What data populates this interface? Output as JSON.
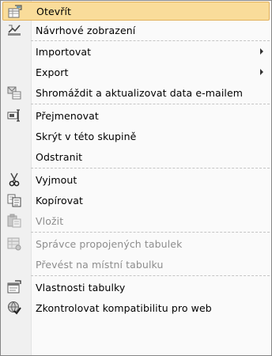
{
  "menu": {
    "items": [
      {
        "label": "Otevřít",
        "icon": "open-table-icon"
      },
      {
        "label": "Návrhové zobrazení",
        "icon": "design-view-icon"
      },
      {
        "label": "Importovat",
        "icon": "",
        "submenu": true
      },
      {
        "label": "Export",
        "icon": "",
        "submenu": true
      },
      {
        "label": "Shromáždit a aktualizovat data e-mailem",
        "icon": "collect-data-email-icon"
      },
      {
        "label": "Přejmenovat",
        "icon": "rename-icon"
      },
      {
        "label": "Skrýt v této skupině",
        "icon": ""
      },
      {
        "label": "Odstranit",
        "icon": ""
      },
      {
        "label": "Vyjmout",
        "icon": "cut-icon"
      },
      {
        "label": "Kopírovat",
        "icon": "copy-icon"
      },
      {
        "label": "Vložit",
        "icon": "paste-icon",
        "disabled": true
      },
      {
        "label": "Správce propojených tabulek",
        "icon": "linked-table-manager-icon",
        "disabled": true
      },
      {
        "label": "Převést na místní tabulku",
        "icon": "",
        "disabled": true
      },
      {
        "label": "Vlastnosti tabulky",
        "icon": "table-properties-icon"
      },
      {
        "label": "Zkontrolovat kompatibilitu pro web",
        "icon": "check-web-compatibility-icon"
      }
    ]
  },
  "colors": {
    "highlight": "#f9dc9a",
    "highlight_border": "#e3b15a",
    "disabled_text": "#8d8d8d"
  }
}
